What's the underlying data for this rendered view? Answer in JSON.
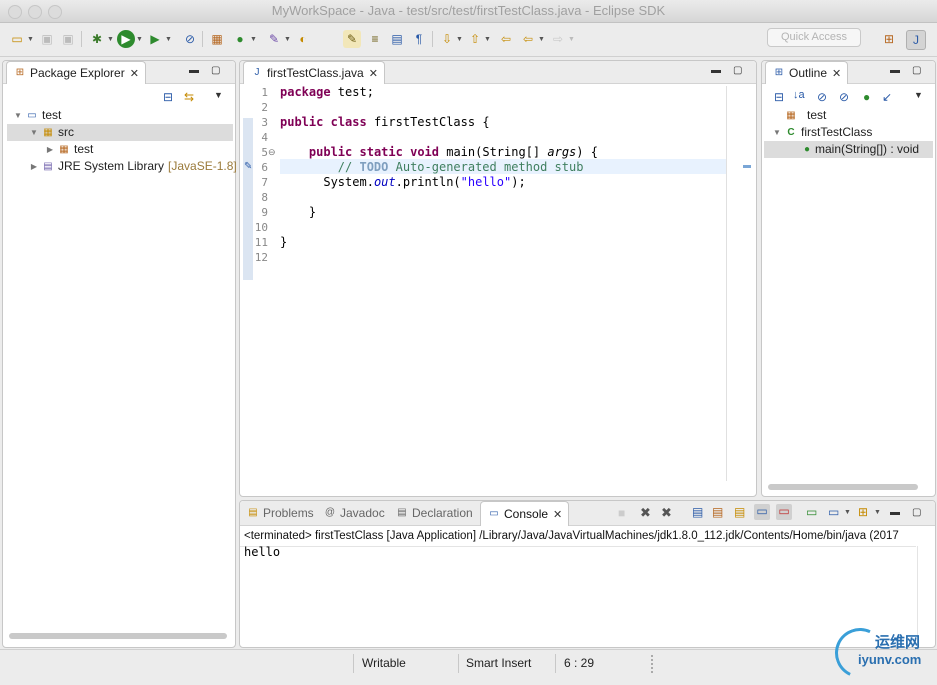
{
  "window": {
    "title": "MyWorkSpace - Java - test/src/test/firstTestClass.java - Eclipse SDK"
  },
  "toolbar": {
    "quick_access_placeholder": "Quick Access"
  },
  "package_explorer": {
    "tab_label": "Package Explorer",
    "tree": [
      {
        "label": "test",
        "depth": 0,
        "expanded": true,
        "icon": "project-icon"
      },
      {
        "label": "src",
        "depth": 1,
        "expanded": true,
        "icon": "source-folder-icon",
        "selected": true
      },
      {
        "label": "test",
        "depth": 2,
        "expanded": false,
        "icon": "package-icon"
      },
      {
        "label": "JRE System Library",
        "suffix": "[JavaSE-1.8]",
        "depth": 1,
        "expanded": false,
        "icon": "library-icon"
      }
    ]
  },
  "editor": {
    "tab_label": "firstTestClass.java",
    "line_numbers": [
      "1",
      "2",
      "3",
      "4",
      "5",
      "6",
      "7",
      "8",
      "9",
      "10",
      "11",
      "12"
    ],
    "lines": {
      "l1_kw": "package",
      "l1_rest": " test;",
      "l3_kw1": "public",
      "l3_kw2": "class",
      "l3_rest": " firstTestClass {",
      "l5_kw1": "public",
      "l5_kw2": "static",
      "l5_kw3": "void",
      "l5_rest": " main(String[] ",
      "l5_arg": "args",
      "l5_end": ") {",
      "l6_slashes": "// ",
      "l6_todo": "TODO",
      "l6_rest": " Auto-generated method stub",
      "l7_pre": "System.",
      "l7_out": "out",
      "l7_mid": ".println(",
      "l7_str": "\"hello\"",
      "l7_end": ");",
      "l9": "}",
      "l11": "}"
    }
  },
  "outline": {
    "tab_label": "Outline",
    "items": [
      {
        "label": "test",
        "icon": "package-declaration-icon"
      },
      {
        "label": "firstTestClass",
        "icon": "class-icon"
      },
      {
        "label": "main(String[]) : void",
        "icon": "method-icon",
        "selected": true
      }
    ]
  },
  "bottom_panel": {
    "tabs": [
      {
        "label": "Problems",
        "active": false
      },
      {
        "label": "Javadoc",
        "active": false
      },
      {
        "label": "Declaration",
        "active": false
      },
      {
        "label": "Console",
        "active": true
      }
    ],
    "console_header": "<terminated> firstTestClass [Java Application] /Library/Java/JavaVirtualMachines/jdk1.8.0_112.jdk/Contents/Home/bin/java (2017",
    "console_output": "hello"
  },
  "statusbar": {
    "writable": "Writable",
    "insert_mode": "Smart Insert",
    "position": "6 : 29"
  },
  "watermark": {
    "text": "运维网",
    "url": "iyunv.com"
  },
  "colors": {
    "keyword": "#7f0055",
    "comment": "#3f7f5f",
    "string": "#2a00ff",
    "selection": "#dcdcdc",
    "current_line": "#e8f2fe"
  }
}
